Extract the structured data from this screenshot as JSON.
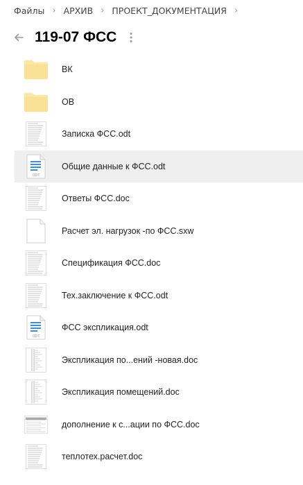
{
  "breadcrumb": [
    "Файлы",
    "АРХИВ",
    "ПРОЕКТ_ДОКУМЕНТАЦИЯ"
  ],
  "title": "119-07 ФСС",
  "accent": "#f9e79f",
  "files": [
    {
      "name": "ВК",
      "kind": "folder",
      "icon": "folder-icon"
    },
    {
      "name": "ОВ",
      "kind": "folder",
      "icon": "folder-icon"
    },
    {
      "name": "Записка ФСС.odt",
      "kind": "preview",
      "icon": "document-preview-icon"
    },
    {
      "name": "Общие данные к ФСС.odt",
      "kind": "odt",
      "icon": "odt-file-icon",
      "selected": true
    },
    {
      "name": "Ответы ФСС.doc",
      "kind": "preview",
      "icon": "document-preview-icon"
    },
    {
      "name": "Расчет эл. нагрузок -по ФСС.sxw",
      "kind": "blank",
      "icon": "blank-file-icon"
    },
    {
      "name": "Спецификация ФСС.doc",
      "kind": "preview",
      "icon": "document-preview-icon"
    },
    {
      "name": "Тех.заключение к ФСС.odt",
      "kind": "preview",
      "icon": "document-preview-icon"
    },
    {
      "name": "ФСС экспликация.odt",
      "kind": "odt",
      "icon": "odt-file-icon"
    },
    {
      "name": "Экспликация по...ений -новая.doc",
      "kind": "table",
      "icon": "table-preview-icon"
    },
    {
      "name": "Экспликация помещений.doc",
      "kind": "table",
      "icon": "table-preview-icon"
    },
    {
      "name": "дополнение к с...ации по ФСС.doc",
      "kind": "landscape",
      "icon": "document-preview-icon"
    },
    {
      "name": "теплотех.расчет.doc",
      "kind": "preview",
      "icon": "document-preview-icon"
    }
  ]
}
